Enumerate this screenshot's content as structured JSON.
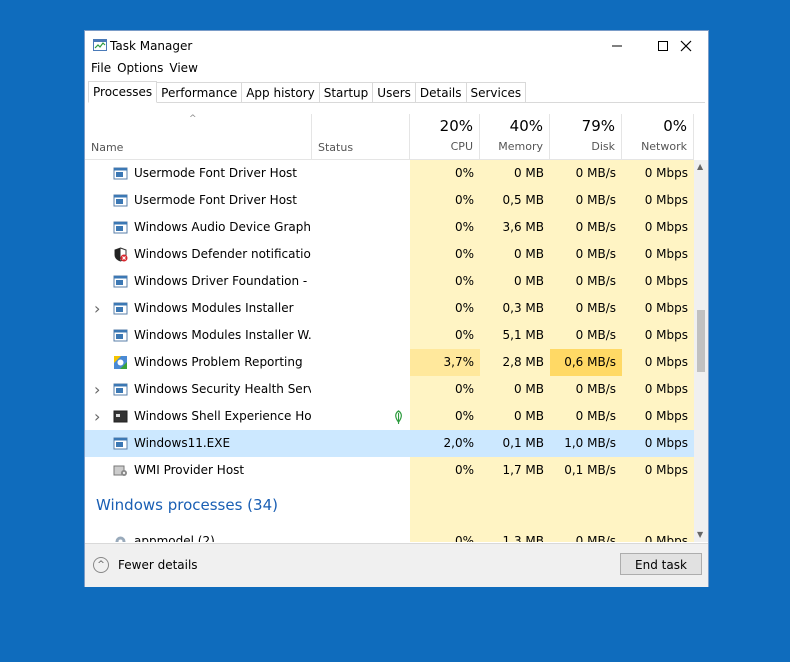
{
  "window": {
    "title": "Task Manager",
    "controls": {
      "minimize": "—",
      "maximize": "☐",
      "close": "✕"
    }
  },
  "menu": [
    "File",
    "Options",
    "View"
  ],
  "tabs": [
    "Processes",
    "Performance",
    "App history",
    "Startup",
    "Users",
    "Details",
    "Services"
  ],
  "active_tab": "Processes",
  "columns": {
    "name": "Name",
    "status": "Status",
    "cpu": {
      "pct": "20%",
      "label": "CPU"
    },
    "memory": {
      "pct": "40%",
      "label": "Memory"
    },
    "disk": {
      "pct": "79%",
      "label": "Disk"
    },
    "network": {
      "pct": "0%",
      "label": "Network"
    }
  },
  "rows": [
    {
      "name": "Usermode Font Driver Host",
      "cpu": "0%",
      "mem": "0 MB",
      "disk": "0 MB/s",
      "net": "0 Mbps",
      "icon": "window-icon"
    },
    {
      "name": "Usermode Font Driver Host",
      "cpu": "0%",
      "mem": "0,5 MB",
      "disk": "0 MB/s",
      "net": "0 Mbps",
      "icon": "window-icon"
    },
    {
      "name": "Windows Audio Device Graph Is...",
      "cpu": "0%",
      "mem": "3,6 MB",
      "disk": "0 MB/s",
      "net": "0 Mbps",
      "icon": "window-icon"
    },
    {
      "name": "Windows Defender notification ...",
      "cpu": "0%",
      "mem": "0 MB",
      "disk": "0 MB/s",
      "net": "0 Mbps",
      "icon": "shield-icon"
    },
    {
      "name": "Windows Driver Foundation - U...",
      "cpu": "0%",
      "mem": "0 MB",
      "disk": "0 MB/s",
      "net": "0 Mbps",
      "icon": "window-icon"
    },
    {
      "name": "Windows Modules Installer",
      "cpu": "0%",
      "mem": "0,3 MB",
      "disk": "0 MB/s",
      "net": "0 Mbps",
      "icon": "window-icon",
      "expandable": true
    },
    {
      "name": "Windows Modules Installer W...",
      "cpu": "0%",
      "mem": "5,1 MB",
      "disk": "0 MB/s",
      "net": "0 Mbps",
      "icon": "window-icon"
    },
    {
      "name": "Windows Problem Reporting",
      "cpu": "3,7%",
      "mem": "2,8 MB",
      "disk": "0,6 MB/s",
      "net": "0 Mbps",
      "icon": "problem-report-icon"
    },
    {
      "name": "Windows Security Health Service",
      "cpu": "0%",
      "mem": "0 MB",
      "disk": "0 MB/s",
      "net": "0 Mbps",
      "icon": "window-icon",
      "expandable": true
    },
    {
      "name": "Windows Shell Experience Host",
      "cpu": "0%",
      "mem": "0 MB",
      "disk": "0 MB/s",
      "net": "0 Mbps",
      "icon": "dark-window-icon",
      "expandable": true,
      "status_icon": "suspended-leaf-icon"
    },
    {
      "name": "Windows11.EXE",
      "cpu": "2,0%",
      "mem": "0,1 MB",
      "disk": "1,0 MB/s",
      "net": "0 Mbps",
      "icon": "window-icon",
      "selected": true
    },
    {
      "name": "WMI Provider Host",
      "cpu": "0%",
      "mem": "1,7 MB",
      "disk": "0,1 MB/s",
      "net": "0 Mbps",
      "icon": "wmi-icon"
    }
  ],
  "section": "Windows processes (34)",
  "partial_row": {
    "name": "appmodel (2)",
    "cpu": "0%",
    "mem": "1,3 MB",
    "disk": "0 MB/s",
    "net": "0 Mbps",
    "icon": "gear-icon"
  },
  "footer": {
    "fewer_details": "Fewer details",
    "end_task": "End task"
  },
  "colors": {
    "selected_row": "#cce8ff",
    "heat_light": "#fff4c4",
    "heat_medium": "#ffe89c",
    "heat_strong": "#ffd965",
    "section_text": "#1a5fb4",
    "desktop": "#0f6cbd"
  }
}
